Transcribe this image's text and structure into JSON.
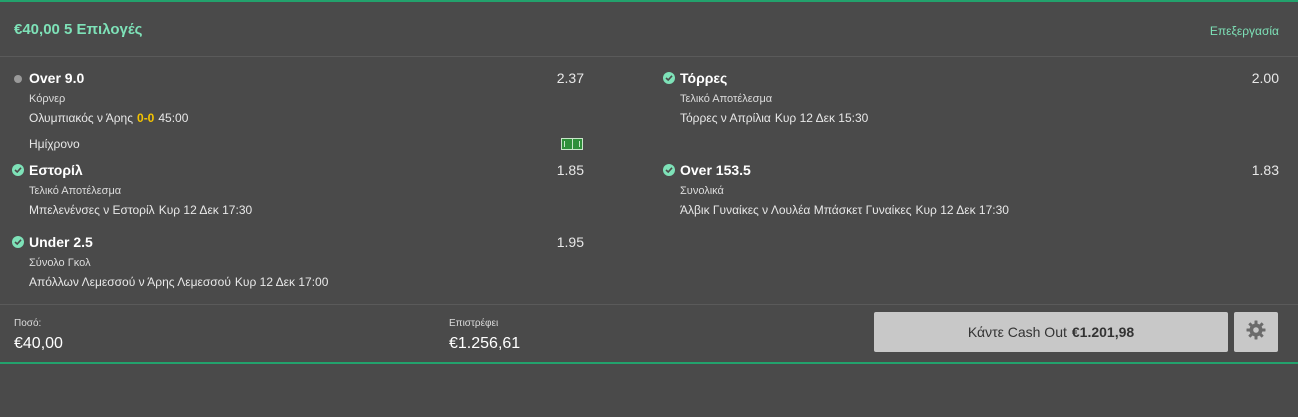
{
  "header": {
    "title": "€40,00 5 Επιλογές",
    "edit_label": "Επεξεργασία"
  },
  "selections_left": [
    {
      "status": "pending",
      "name": "Over 9.0",
      "odds": "2.37",
      "market": "Κόρνερ",
      "event": "Ολυμπιακός ν Άρης",
      "score": "0-0",
      "time": "45:00",
      "extra": "Ημίχρονο"
    },
    {
      "status": "won",
      "name": "Εστορίλ",
      "odds": "1.85",
      "market": "Τελικό Αποτέλεσμα",
      "event": "Μπελενένσες ν Εστορίλ",
      "time": "Κυρ 12 Δεκ 17:30"
    },
    {
      "status": "won",
      "name": "Under 2.5",
      "odds": "1.95",
      "market": "Σύνολο Γκολ",
      "event": "Απόλλων Λεμεσσού ν Άρης Λεμεσσού",
      "time": "Κυρ 12 Δεκ 17:00"
    }
  ],
  "selections_right": [
    {
      "status": "won",
      "name": "Τόρρες",
      "odds": "2.00",
      "market": "Τελικό Αποτέλεσμα",
      "event": "Τόρρες ν Απρίλια",
      "time": "Κυρ 12 Δεκ 15:30"
    },
    {
      "status": "won",
      "name": "Over 153.5",
      "odds": "1.83",
      "market": "Συνολικά",
      "event": "Άλβικ Γυναίκες ν Λουλέα Μπάσκετ Γυναίκες",
      "time": "Κυρ 12 Δεκ 17:30"
    }
  ],
  "footer": {
    "stake_label": "Ποσό:",
    "stake_value": "€40,00",
    "returns_label": "Επιστρέφει",
    "returns_value": "€1.256,61",
    "cashout_label": "Κάντε Cash Out",
    "cashout_amount": "€1.201,98"
  },
  "icons": {
    "pending": "grey-dot-icon",
    "won": "check-circle-icon",
    "live": "pitch-icon",
    "settings": "gear-icon"
  },
  "colors": {
    "accent": "#7ee2b8",
    "divider": "#23a26d",
    "score": "#f5c400",
    "background": "#4a4a4a",
    "button": "#c8c8c8"
  }
}
